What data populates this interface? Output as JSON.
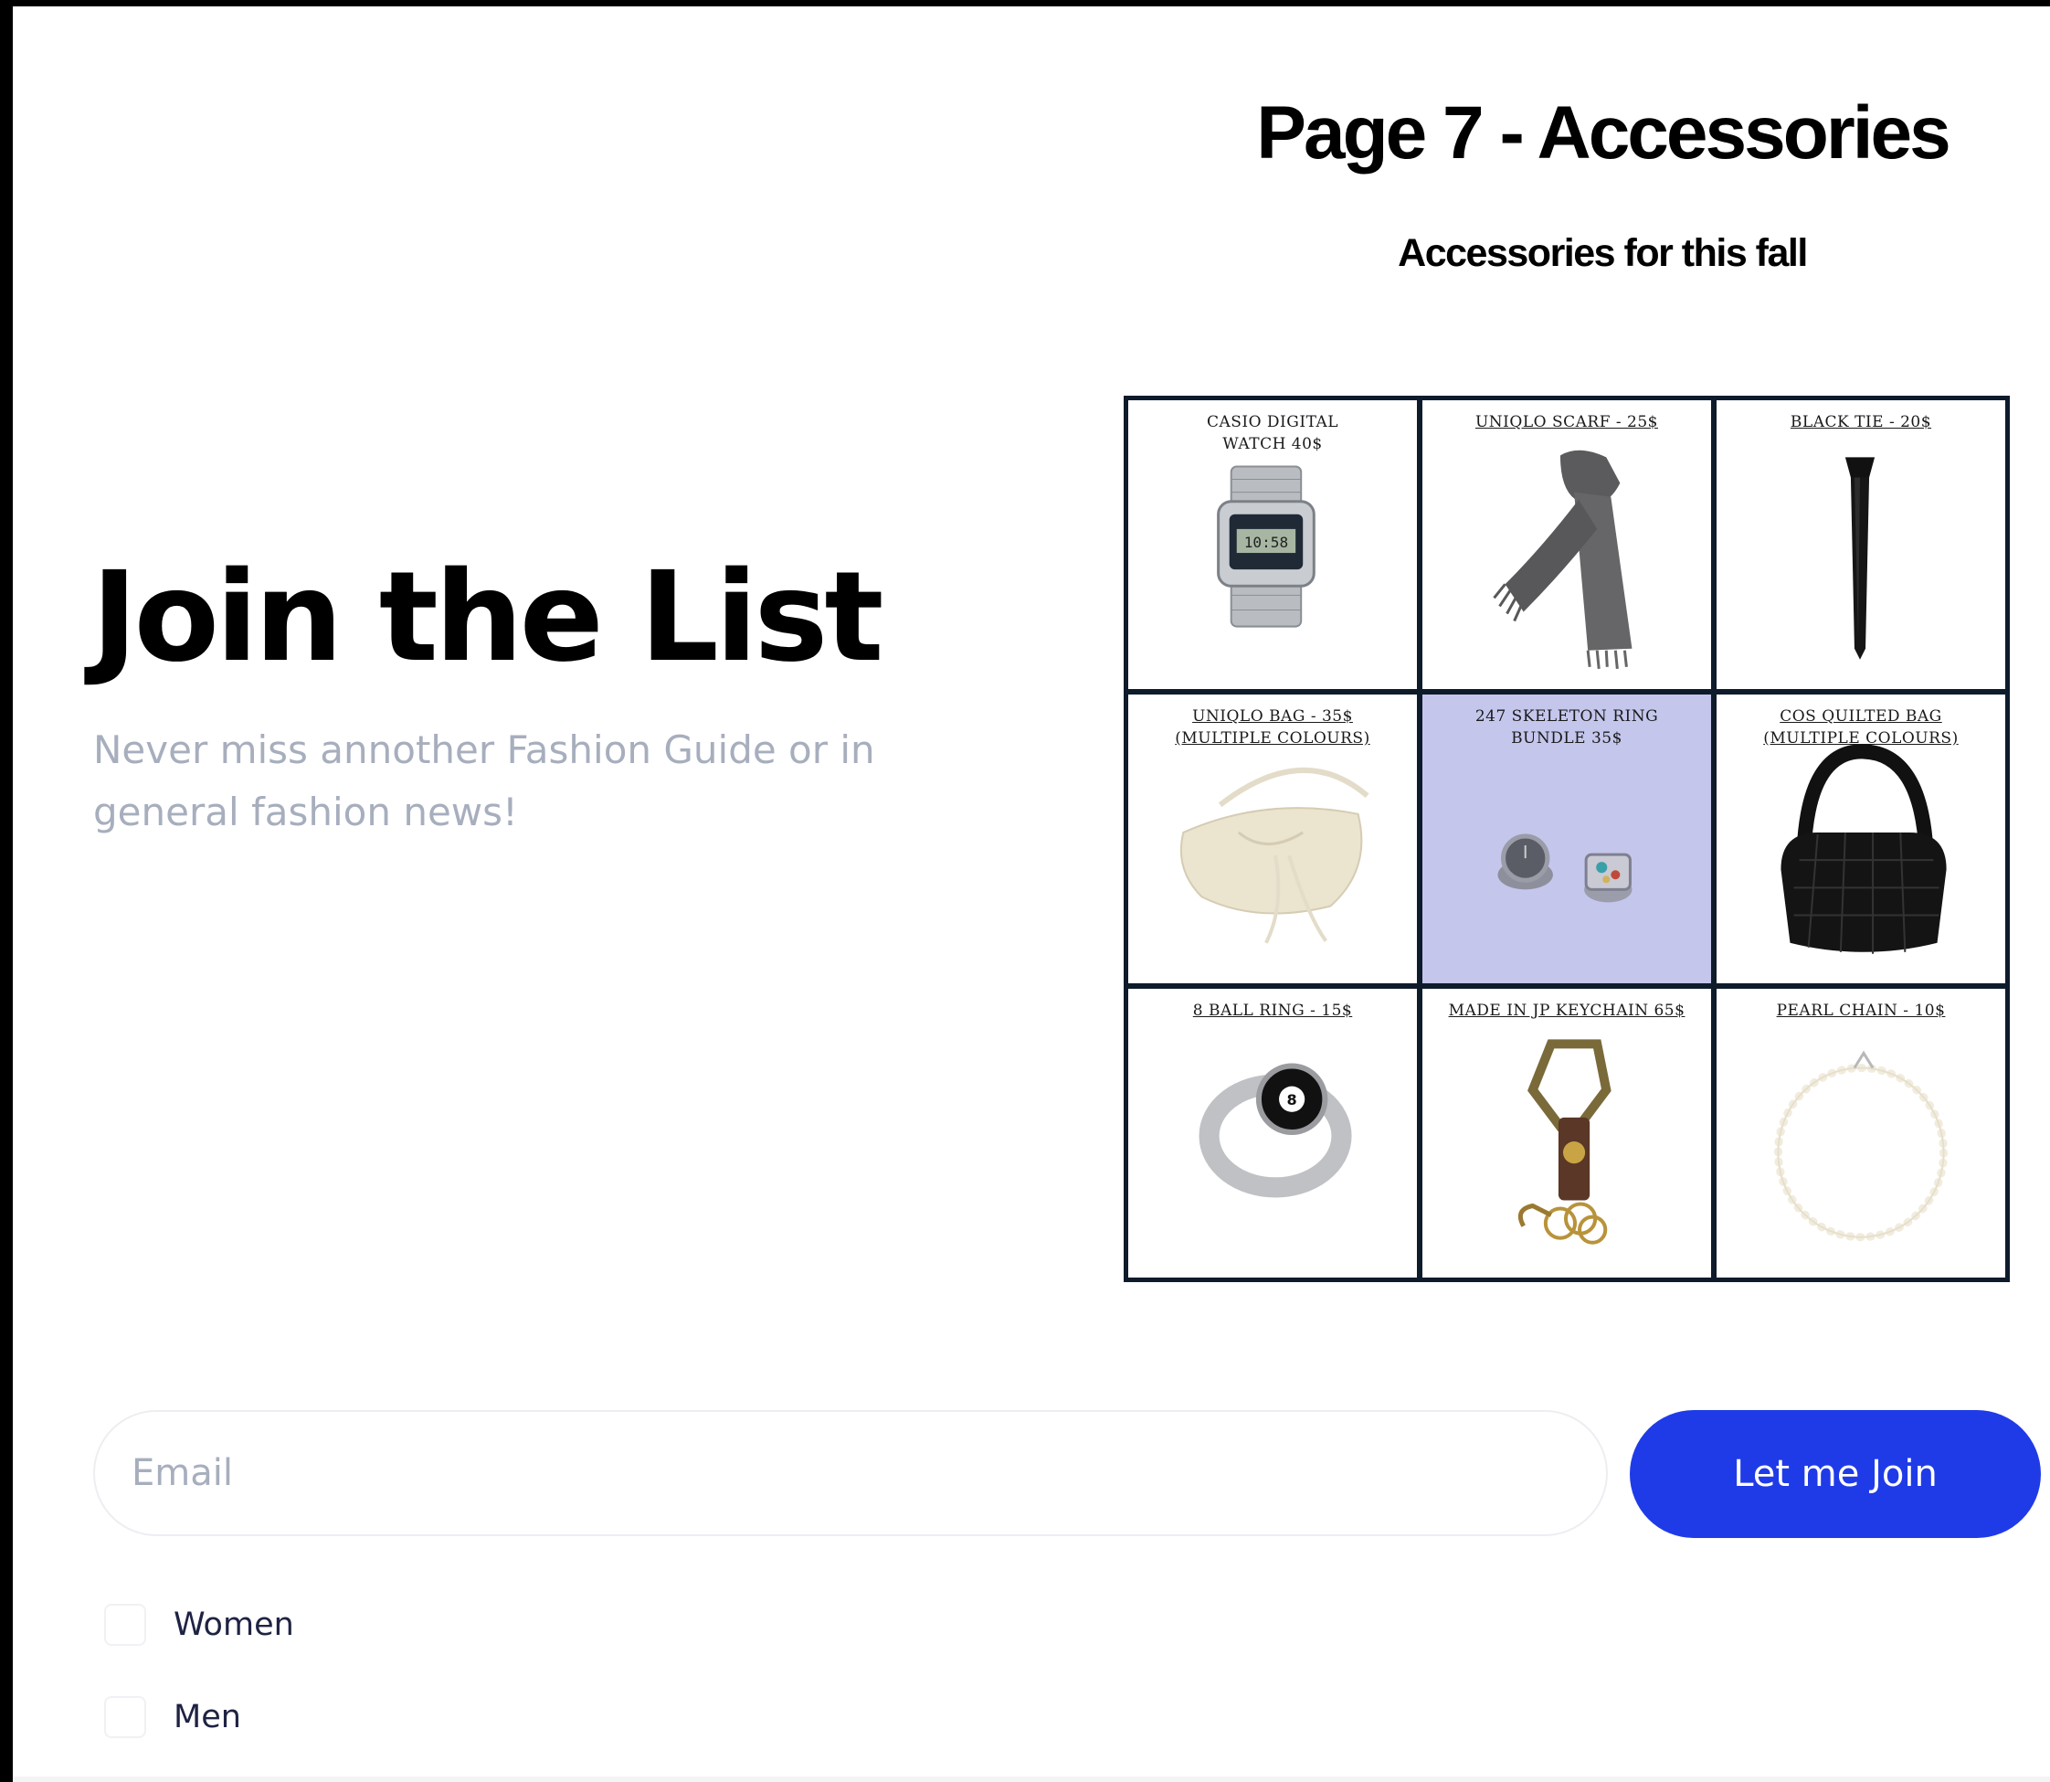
{
  "header": {
    "title": "Page 7 - Accessories",
    "subtitle": "Accessories for this fall"
  },
  "signup": {
    "title": "Join the List",
    "description": "Never miss annother Fashion Guide or in general fashion news!",
    "email_placeholder": "Email",
    "email_value": "",
    "submit_label": "Let me Join",
    "options": [
      {
        "label": "Women",
        "checked": false
      },
      {
        "label": "Men",
        "checked": false
      }
    ]
  },
  "accessories": {
    "items": [
      {
        "label": "CASIO DIGITAL\nWATCH 40$",
        "underlined": false,
        "icon": "watch-icon"
      },
      {
        "label": "UNIQLO SCARF - 25$",
        "underlined": true,
        "icon": "scarf-icon"
      },
      {
        "label": "BLACK TIE - 20$",
        "underlined": true,
        "icon": "tie-icon"
      },
      {
        "label": "UNIQLO BAG - 35$\n(MULTIPLE COLOURS)",
        "underlined": true,
        "icon": "bag-icon"
      },
      {
        "label": "247 SKELETON RING\nBUNDLE 35$",
        "underlined": false,
        "icon": "rings-icon",
        "background": "#c4c6ec"
      },
      {
        "label": "COS QUILTED BAG\n(MULTIPLE COLOURS)",
        "underlined": true,
        "icon": "quilted-bag-icon"
      },
      {
        "label": "8 BALL RING - 15$",
        "underlined": true,
        "icon": "eight-ball-ring-icon"
      },
      {
        "label": "MADE IN JP KEYCHAIN 65$",
        "underlined": true,
        "icon": "keychain-icon"
      },
      {
        "label": "PEARL CHAIN - 10$",
        "underlined": true,
        "icon": "pearl-chain-icon"
      }
    ]
  },
  "colors": {
    "accent": "#1f3be8",
    "muted_text": "#a7aebd",
    "grid_border": "#0e1b2b"
  }
}
